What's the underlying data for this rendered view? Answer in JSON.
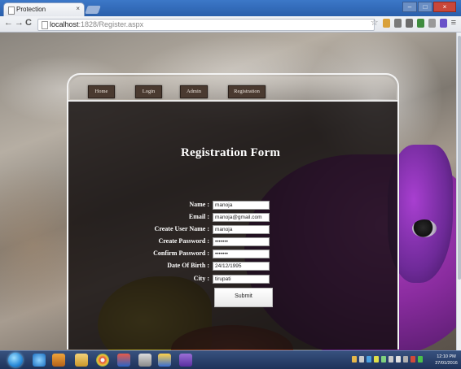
{
  "browser": {
    "tab_title": "Protection",
    "tab_close": "×",
    "nav": {
      "back": "←",
      "forward": "→",
      "reload": "C"
    },
    "url_host": "localhost",
    "url_path": ":1828/Register.aspx",
    "bookmark_icon": "star-icon",
    "menu_icon": "≡",
    "window_buttons": {
      "minimize": "–",
      "maximize": "□",
      "close": "×"
    }
  },
  "site": {
    "nav": [
      {
        "label": "Home"
      },
      {
        "label": "Login"
      },
      {
        "label": "Admin"
      },
      {
        "label": "Registration"
      }
    ],
    "form_title": "Registration Form",
    "fields": [
      {
        "label": "Name :",
        "value": "manoja"
      },
      {
        "label": "Email :",
        "value": "manoja@gmail.com"
      },
      {
        "label": "Create User Name :",
        "value": "manoja"
      },
      {
        "label": "Create Password :",
        "value": "•••••••"
      },
      {
        "label": "Confirm Password :",
        "value": "•••••••"
      },
      {
        "label": "Date Of Birth :",
        "value": "24/12/1995"
      },
      {
        "label": "City :",
        "value": "tirupati"
      }
    ],
    "submit_label": "Submit"
  },
  "taskbar": {
    "time": "12:10 PM",
    "date": "27/01/2016"
  },
  "colors": {
    "form_background": "#120e0e",
    "nav_button": "#4a3a30",
    "fish_purple": "#8a2c9f",
    "taskbar": "#1d3158"
  }
}
